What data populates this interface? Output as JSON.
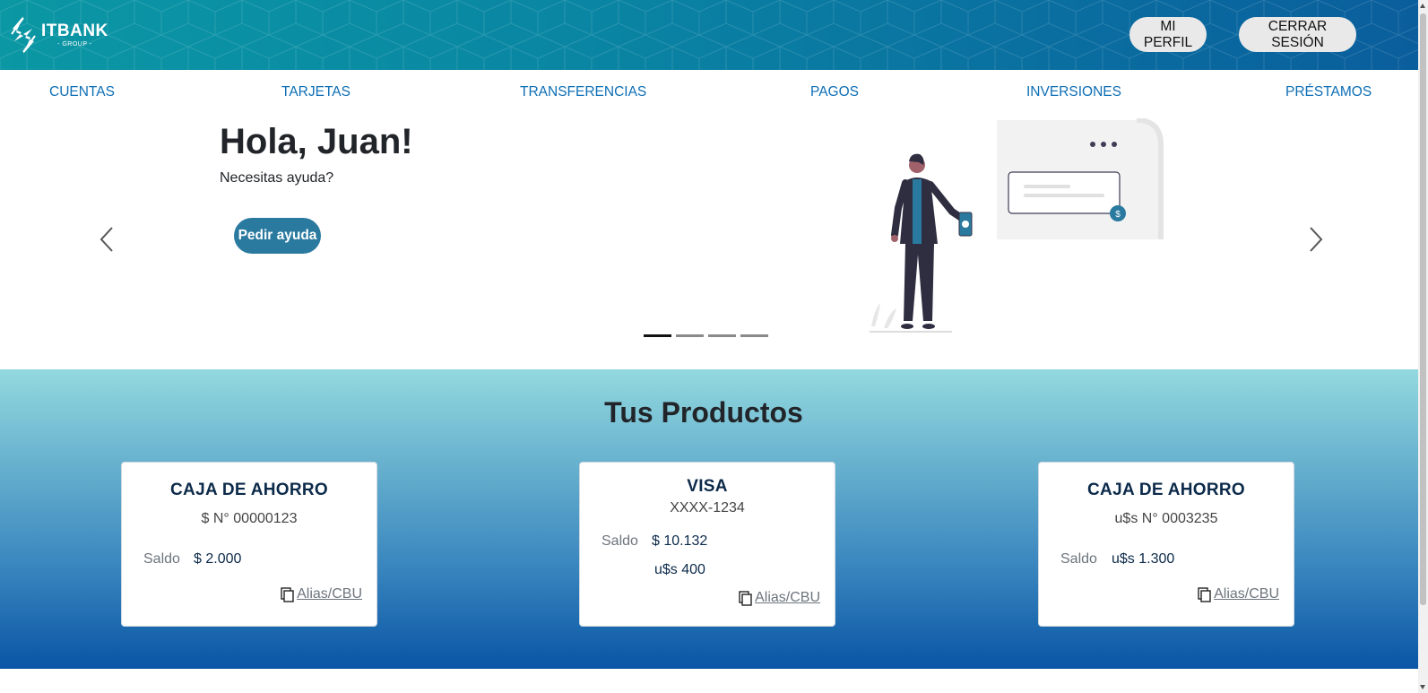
{
  "header": {
    "logo_main": "ITBANK",
    "logo_sub": "- GROUP -",
    "profile_label": "MI PERFIL",
    "logout_label": "CERRAR SESIÓN"
  },
  "nav": {
    "items": [
      {
        "label": "CUENTAS"
      },
      {
        "label": "TARJETAS"
      },
      {
        "label": "TRANSFERENCIAS"
      },
      {
        "label": "PAGOS"
      },
      {
        "label": "INVERSIONES"
      },
      {
        "label": "PRÉSTAMOS"
      }
    ]
  },
  "hero": {
    "title": "Hola, Juan!",
    "subtitle": "Necesitas ayuda?",
    "button_label": "Pedir ayuda",
    "slide_count": 4,
    "active_slide": 1
  },
  "products": {
    "title": "Tus Productos",
    "cards": [
      {
        "title": "CAJA DE AHORRO",
        "number": "$ N° 00000123",
        "balance_label": "Saldo",
        "balance": "$ 2.000",
        "alias_label": "Alias/CBU"
      },
      {
        "title": "VISA",
        "number": "XXXX-1234",
        "balance_label": "Saldo",
        "balance": "$ 10.132",
        "balance_usd": "u$s 400",
        "alias_label": "Alias/CBU"
      },
      {
        "title": "CAJA DE AHORRO",
        "number": "u$s N° 0003235",
        "balance_label": "Saldo",
        "balance": "u$s 1.300",
        "alias_label": "Alias/CBU"
      }
    ]
  },
  "colors": {
    "header_gradient_start": "#0b97a4",
    "header_gradient_end": "#0a5e9c",
    "nav_link": "#0d6eb5",
    "help_button": "#2a7aa0",
    "products_gradient_top": "#93d9df",
    "products_gradient_bottom": "#0a55a5"
  },
  "icons": {
    "logo": "itbank-logo-icon",
    "prev": "chevron-left-icon",
    "next": "chevron-right-icon",
    "copy": "copy-icon"
  }
}
